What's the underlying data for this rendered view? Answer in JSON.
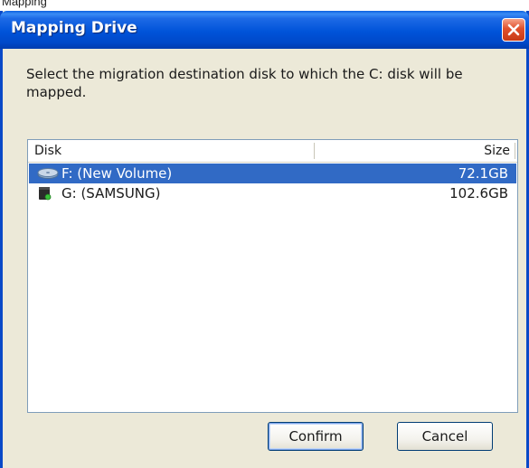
{
  "window": {
    "title": "Mapping Drive",
    "instruction": "Select the migration destination disk to which the C: disk will be mapped."
  },
  "top_strip_text": "Mapping",
  "list": {
    "columns": {
      "disk": "Disk",
      "size": "Size"
    },
    "rows": [
      {
        "name": "F: (New Volume)",
        "size": "72.1GB",
        "icon": "drive-icon",
        "selected": true
      },
      {
        "name": "G: (SAMSUNG)",
        "size": "102.6GB",
        "icon": "removable-drive-icon",
        "selected": false
      }
    ]
  },
  "buttons": {
    "confirm": "Confirm",
    "cancel": "Cancel"
  },
  "colors": {
    "selection": "#316ac5",
    "titlebar": "#0053d9",
    "dialog_bg": "#ece9d8"
  }
}
